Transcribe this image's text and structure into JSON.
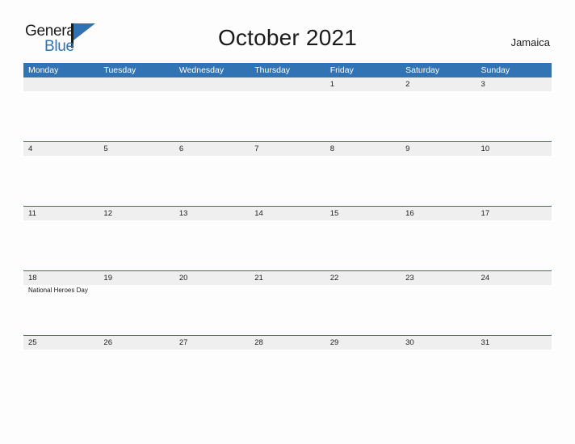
{
  "brand": {
    "name_part1": "General",
    "name_part2": "Blue",
    "mark": "triangle-flag-logo",
    "color_dark": "#1b1b1b",
    "color_blue": "#2f72b6"
  },
  "header": {
    "title": "October 2021",
    "country": "Jamaica"
  },
  "colors": {
    "header_blue": "#3273b3",
    "rule_blue": "#2a6ba8",
    "date_band": "#efefef",
    "page_background": "#fdfdfd",
    "text": "#1b1b1b"
  },
  "calendar": {
    "weekdays": [
      "Monday",
      "Tuesday",
      "Wednesday",
      "Thursday",
      "Friday",
      "Saturday",
      "Sunday"
    ],
    "weeks": [
      {
        "days": [
          {
            "num": "",
            "event": ""
          },
          {
            "num": "",
            "event": ""
          },
          {
            "num": "",
            "event": ""
          },
          {
            "num": "",
            "event": ""
          },
          {
            "num": "1",
            "event": ""
          },
          {
            "num": "2",
            "event": ""
          },
          {
            "num": "3",
            "event": ""
          }
        ]
      },
      {
        "days": [
          {
            "num": "4",
            "event": ""
          },
          {
            "num": "5",
            "event": ""
          },
          {
            "num": "6",
            "event": ""
          },
          {
            "num": "7",
            "event": ""
          },
          {
            "num": "8",
            "event": ""
          },
          {
            "num": "9",
            "event": ""
          },
          {
            "num": "10",
            "event": ""
          }
        ]
      },
      {
        "days": [
          {
            "num": "11",
            "event": ""
          },
          {
            "num": "12",
            "event": ""
          },
          {
            "num": "13",
            "event": ""
          },
          {
            "num": "14",
            "event": ""
          },
          {
            "num": "15",
            "event": ""
          },
          {
            "num": "16",
            "event": ""
          },
          {
            "num": "17",
            "event": ""
          }
        ]
      },
      {
        "days": [
          {
            "num": "18",
            "event": "National Heroes Day"
          },
          {
            "num": "19",
            "event": ""
          },
          {
            "num": "20",
            "event": ""
          },
          {
            "num": "21",
            "event": ""
          },
          {
            "num": "22",
            "event": ""
          },
          {
            "num": "23",
            "event": ""
          },
          {
            "num": "24",
            "event": ""
          }
        ]
      },
      {
        "days": [
          {
            "num": "25",
            "event": ""
          },
          {
            "num": "26",
            "event": ""
          },
          {
            "num": "27",
            "event": ""
          },
          {
            "num": "28",
            "event": ""
          },
          {
            "num": "29",
            "event": ""
          },
          {
            "num": "30",
            "event": ""
          },
          {
            "num": "31",
            "event": ""
          }
        ]
      }
    ]
  }
}
